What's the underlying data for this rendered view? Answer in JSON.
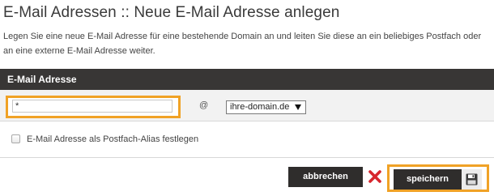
{
  "page": {
    "title": "E-Mail Adressen :: Neue E-Mail Adresse anlegen",
    "intro": "Legen Sie eine neue E-Mail Adresse für eine bestehende Domain an und leiten Sie diese an ein beliebiges Postfach oder an eine externe E-Mail Adresse weiter."
  },
  "panel": {
    "header": "E-Mail Adresse"
  },
  "form": {
    "email_value": "*",
    "at_sign": "@",
    "domain_selected": "ihre-domain.de",
    "alias_label": "E-Mail Adresse als Postfach-Alias festlegen",
    "alias_checked": false
  },
  "actions": {
    "cancel_label": "abbrechen",
    "save_label": "speichern"
  },
  "icons": {
    "cancel": "close-x-icon",
    "save": "floppy-disk-icon",
    "dropdown": "dropdown-arrow-icon"
  },
  "colors": {
    "highlight": "#f0a226",
    "header_bg": "#383635",
    "button_bg": "#2f2d2c",
    "cancel_icon": "#d7262d"
  }
}
